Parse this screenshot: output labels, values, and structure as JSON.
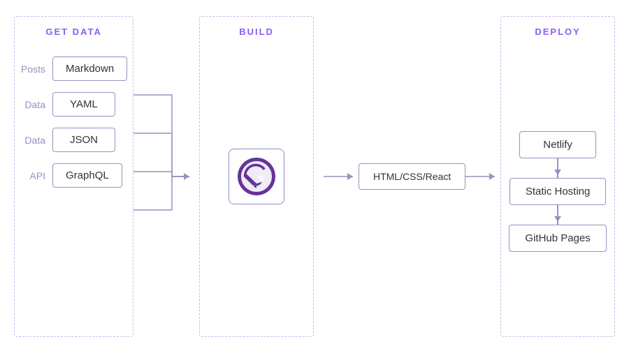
{
  "diagram": {
    "columns": {
      "get_data": {
        "header": "GET DATA",
        "items": [
          {
            "label": "Posts",
            "box": "Markdown"
          },
          {
            "label": "Data",
            "box": "YAML"
          },
          {
            "label": "Data",
            "box": "JSON"
          },
          {
            "label": "API",
            "box": "GraphQL"
          }
        ]
      },
      "build": {
        "header": "BUILD",
        "output_box": "HTML/CSS/React"
      },
      "deploy": {
        "header": "DEPLOY",
        "items": [
          "Netlify",
          "Static Hosting",
          "GitHub Pages"
        ]
      }
    }
  },
  "colors": {
    "purple": "#8b5cf6",
    "purple_mid": "#9b8fc0",
    "purple_light": "#c8b8e8",
    "text": "#333"
  }
}
